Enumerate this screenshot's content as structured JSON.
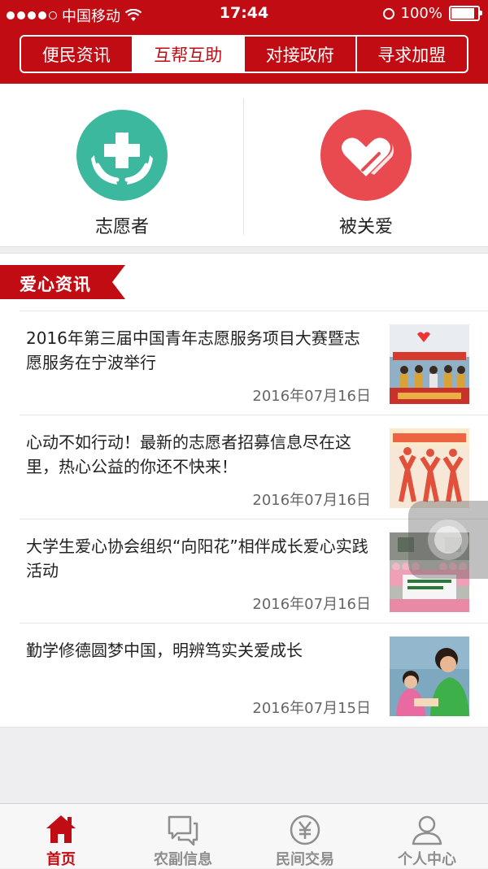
{
  "status_bar": {
    "carrier": "中国移动",
    "time": "17:44",
    "battery": "100%",
    "battery_level": 1.0
  },
  "tabs": [
    {
      "label": "便民资讯",
      "active": false
    },
    {
      "label": "互帮互助",
      "active": true
    },
    {
      "label": "对接政府",
      "active": false
    },
    {
      "label": "寻求加盟",
      "active": false
    }
  ],
  "quick_actions": [
    {
      "label": "志愿者",
      "icon": "volunteer-cross-hands-icon",
      "color": "#3bb89e"
    },
    {
      "label": "被关爱",
      "icon": "hearts-icon",
      "color": "#e84a4f"
    }
  ],
  "news": {
    "section_title": "爱心资讯",
    "items": [
      {
        "title": "2016年第三届中国青年志愿服务项目大赛暨志愿服务在宁波举行",
        "date": "2016年07月16日"
      },
      {
        "title": "心动不如行动！最新的志愿者招募信息尽在这里，热心公益的你还不快来！",
        "date": "2016年07月16日"
      },
      {
        "title": "大学生爱心协会组织“向阳花”相伴成长爱心实践活动",
        "date": "2016年07月16日"
      },
      {
        "title": "勤学修德圆梦中国，明辨笃实关爱成长",
        "date": "2016年07月15日"
      }
    ]
  },
  "bottom_nav": [
    {
      "label": "首页",
      "icon": "home-icon",
      "active": true
    },
    {
      "label": "农副信息",
      "icon": "chat-bubbles-icon",
      "active": false
    },
    {
      "label": "民间交易",
      "icon": "yuan-circle-icon",
      "active": false
    },
    {
      "label": "个人中心",
      "icon": "person-icon",
      "active": false
    }
  ],
  "colors": {
    "brand_red": "#c20c13",
    "inactive_gray": "#8e8e8e"
  }
}
